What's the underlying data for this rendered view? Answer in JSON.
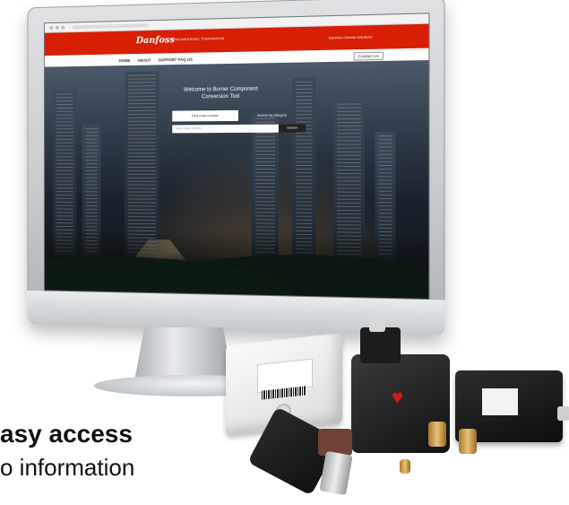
{
  "browser": {},
  "site": {
    "logo": "Danfoss",
    "tagline": "ENGINEERING TOMORROW",
    "header_link": "Danfoss Climate Solutions",
    "nav": [
      "HOME",
      "ABOUT",
      "SUPPORT FAQ US"
    ],
    "contact_label": "Contact Us",
    "welcome_title": "Welcome to Burner Component Conversion Tool",
    "tabs": [
      "Find code number",
      "Search by category"
    ],
    "search_placeholder": "Input code number",
    "search_button": "Search",
    "help_text": ""
  },
  "products": {},
  "caption": {
    "line1": "asy access",
    "line2": "o information"
  }
}
